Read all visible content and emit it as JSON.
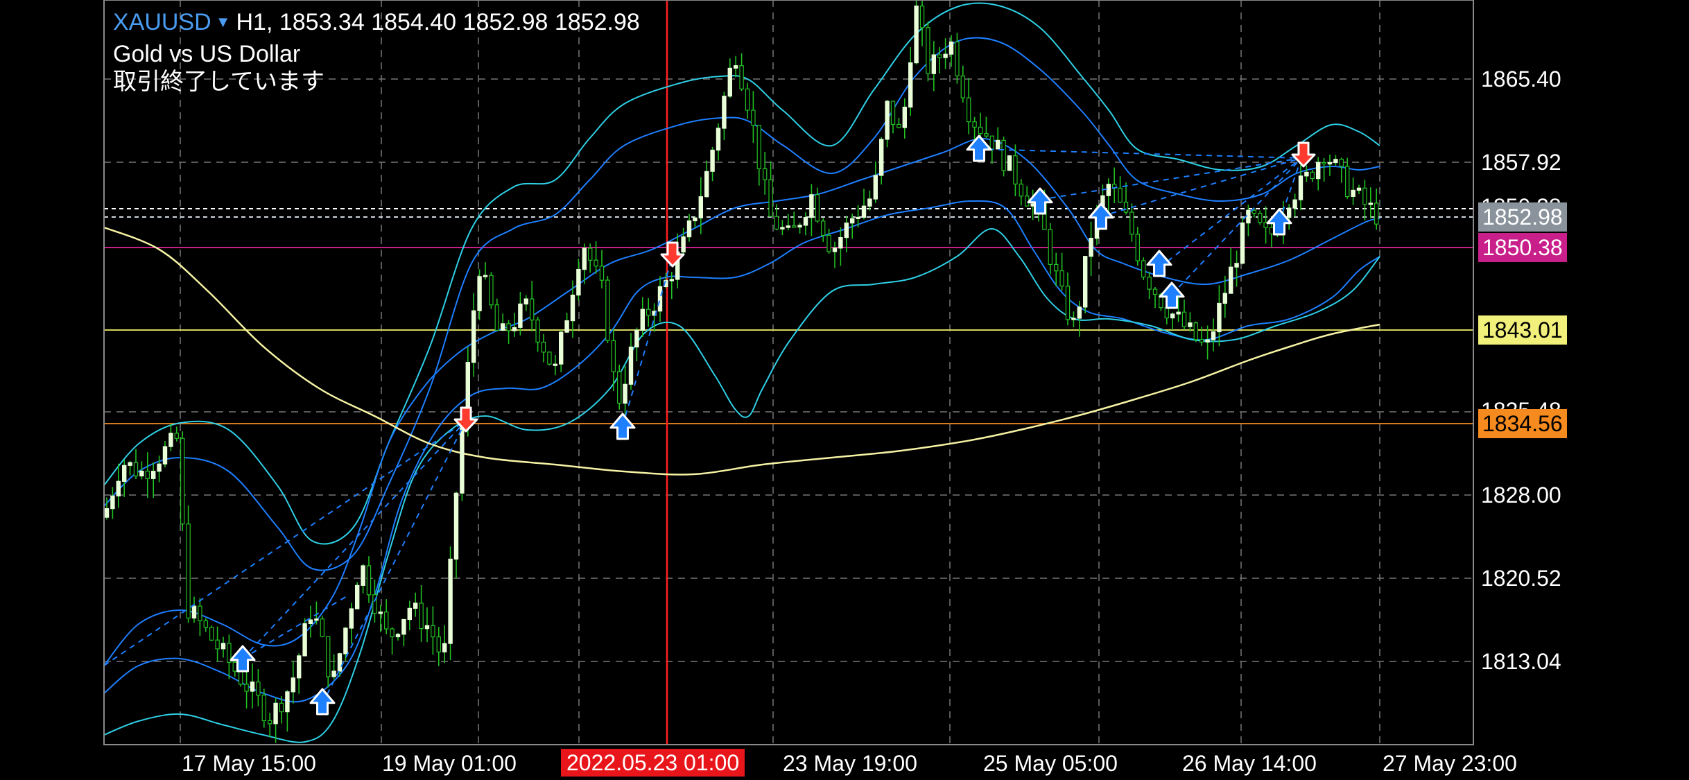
{
  "header": {
    "symbol": "XAUUSD",
    "dropdown_glyph": "▼",
    "timeframe_ohlc": "H1, 1853.34 1854.40 1852.98 1852.98",
    "description": "Gold vs US Dollar",
    "status": "取引終了しています"
  },
  "price_axis": {
    "labels": [
      "1865.40",
      "1857.92",
      "1828.00",
      "1820.52",
      "1813.04"
    ],
    "hidden_labels": [
      "1850.38",
      "1835.48"
    ],
    "tags": [
      {
        "text": "1852.98",
        "bg": "#8a939c",
        "fg": "#ffffff"
      },
      {
        "text": "1850.38",
        "bg": "#c81f8b",
        "fg": "#ffffff"
      },
      {
        "text": "1843.01",
        "bg": "#f0f07a",
        "fg": "#000000"
      },
      {
        "text": "1834.56",
        "bg": "#f58a1e",
        "fg": "#000000"
      }
    ]
  },
  "time_axis": {
    "labels": [
      "17 May 15:00",
      "19 May 01:00",
      "23 May 19:00",
      "25 May 05:00",
      "26 May 14:00",
      "27 May 23:00"
    ],
    "crosshair_time": "2022.05.23 01:00"
  },
  "colors": {
    "background": "#000000",
    "grid": "#777777",
    "bull_candle": "#e8ffd8",
    "bear_candle_wick": "#22c022",
    "bollinger_outer": "#2fd0e6",
    "bollinger_mid": "#1e7fff",
    "moving_average": "#f5f2a4",
    "crosshair": "#ff2020",
    "buy_arrow": "#1e7fff",
    "sell_arrow": "#ff3b30"
  },
  "icons": {
    "buy": "up-arrow-icon",
    "sell": "down-arrow-icon"
  }
}
